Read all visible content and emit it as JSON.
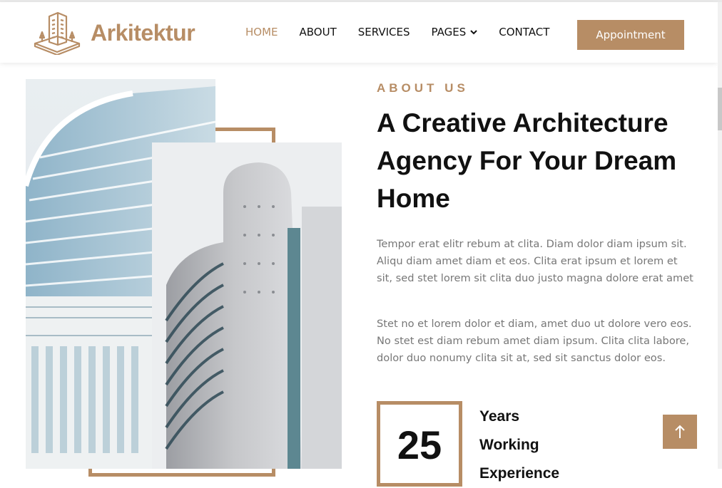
{
  "brand": {
    "name": "Arkitektur",
    "logo_icon": "building-logo-icon"
  },
  "nav": {
    "items": [
      {
        "label": "HOME",
        "active": true
      },
      {
        "label": "ABOUT",
        "active": false
      },
      {
        "label": "SERVICES",
        "active": false
      },
      {
        "label": "PAGES",
        "active": false,
        "has_dropdown": true
      },
      {
        "label": "CONTACT",
        "active": false
      }
    ],
    "cta_label": "Appointment"
  },
  "about": {
    "eyebrow": "ABOUT US",
    "heading": "A Creative Architecture Agency For Your Dream Home",
    "paragraphs": [
      "Tempor erat elitr rebum at clita. Diam dolor diam ipsum sit. Aliqu diam amet diam et eos. Clita erat ipsum et lorem et sit, sed stet lorem sit clita duo justo magna dolore erat amet",
      "Stet no et lorem dolor et diam, amet duo ut dolore vero eos. No stet est diam rebum amet diam ipsum. Clita clita labore, dolor duo nonumy clita sit at, sed sit sanctus dolor eos."
    ],
    "years_number": "25",
    "years_label": "Years Working Experience"
  },
  "back_to_top_icon": "arrow-up-icon",
  "colors": {
    "accent": "#b78d65",
    "text_dark": "#111111",
    "text_muted": "#777777"
  }
}
